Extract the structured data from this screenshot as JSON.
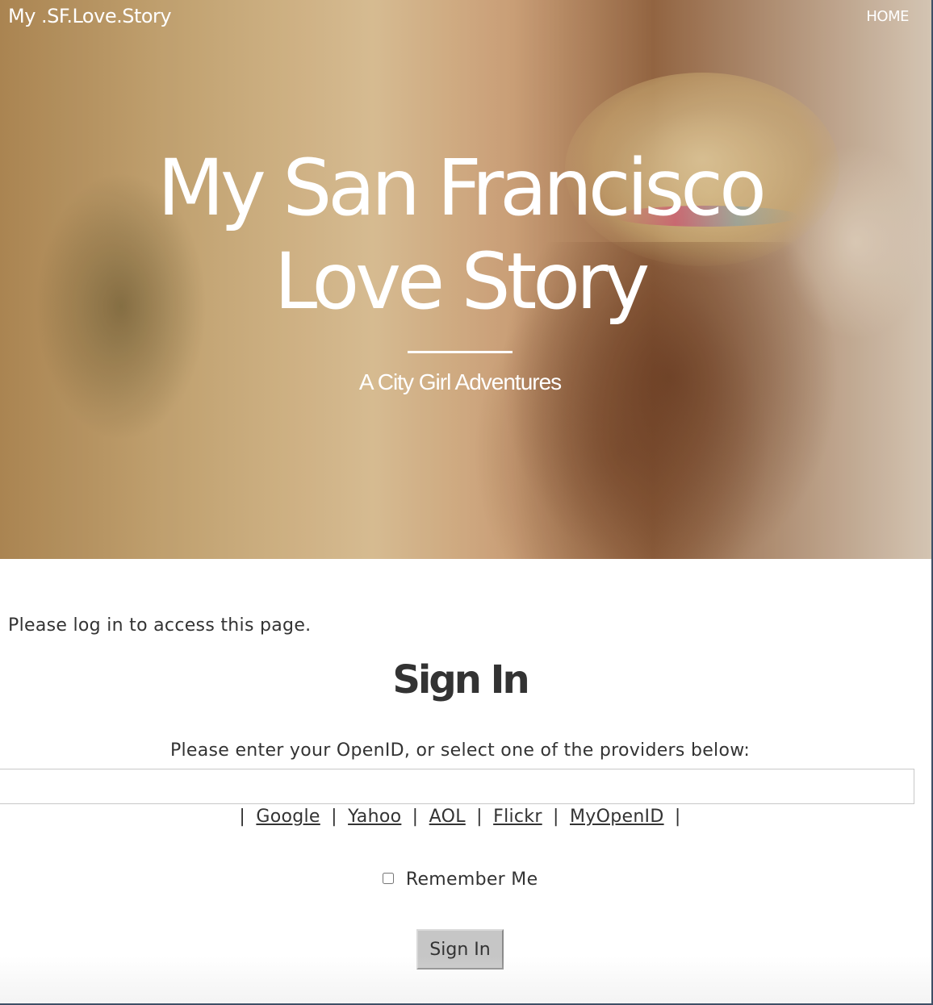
{
  "header": {
    "brand": "My .SF.Love.Story",
    "nav_home": "HOME"
  },
  "hero": {
    "title_line1": "My San Francisco",
    "title_line2": "Love Story",
    "subtitle": "A City Girl Adventures"
  },
  "main": {
    "notice": "Please log in to access this page.",
    "signin_title": "Sign In",
    "instructions": "Please enter your OpenID, or select one of the providers below:",
    "openid_value": "",
    "providers": [
      "Google",
      "Yahoo",
      "AOL",
      "Flickr",
      "MyOpenID"
    ],
    "separator": "|",
    "remember_label": "Remember Me",
    "remember_checked": false,
    "submit_label": "Sign In"
  },
  "colors": {
    "text": "#333333",
    "hero_text": "#ffffff",
    "button_bg": "#c6c6c6",
    "input_border": "#c8c8c8"
  }
}
